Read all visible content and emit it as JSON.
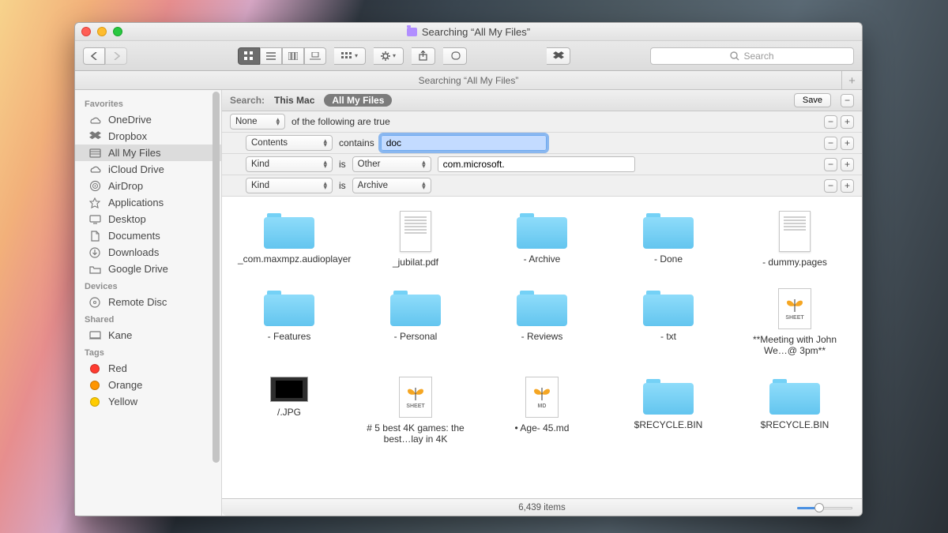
{
  "window_title": "Searching “All My Files”",
  "tab_title": "Searching “All My Files”",
  "toolbar": {
    "search_placeholder": "Search"
  },
  "sidebar": {
    "sections": [
      {
        "header": "Favorites",
        "items": [
          {
            "icon": "onedrive",
            "label": "OneDrive"
          },
          {
            "icon": "dropbox",
            "label": "Dropbox"
          },
          {
            "icon": "allmyfiles",
            "label": "All My Files",
            "selected": true
          },
          {
            "icon": "icloud",
            "label": "iCloud Drive"
          },
          {
            "icon": "airdrop",
            "label": "AirDrop"
          },
          {
            "icon": "applications",
            "label": "Applications"
          },
          {
            "icon": "desktop",
            "label": "Desktop"
          },
          {
            "icon": "documents",
            "label": "Documents"
          },
          {
            "icon": "downloads",
            "label": "Downloads"
          },
          {
            "icon": "folder",
            "label": "Google Drive"
          }
        ]
      },
      {
        "header": "Devices",
        "items": [
          {
            "icon": "disc",
            "label": "Remote Disc"
          }
        ]
      },
      {
        "header": "Shared",
        "items": [
          {
            "icon": "computer",
            "label": "Kane"
          }
        ]
      },
      {
        "header": "Tags",
        "items": [
          {
            "icon": "tag",
            "color": "#ff3b30",
            "label": "Red"
          },
          {
            "icon": "tag",
            "color": "#ff9500",
            "label": "Orange"
          },
          {
            "icon": "tag",
            "color": "#ffcc00",
            "label": "Yellow"
          }
        ]
      }
    ]
  },
  "search": {
    "label": "Search:",
    "scope_this_mac": "This Mac",
    "scope_active": "All My Files",
    "save_label": "Save"
  },
  "criteria": [
    {
      "level": 0,
      "attr": "None",
      "text": "of the following are true"
    },
    {
      "level": 1,
      "attr": "Contents",
      "op": "contains",
      "value": "doc",
      "focused": true
    },
    {
      "level": 1,
      "attr": "Kind",
      "op": "is",
      "value_select": "Other",
      "value_text": "com.microsoft."
    },
    {
      "level": 1,
      "attr": "Kind",
      "op": "is",
      "value_select": "Archive"
    }
  ],
  "files": [
    {
      "type": "folder",
      "name": "_com.maxmpz.audioplayer"
    },
    {
      "type": "pdf",
      "name": "_jubilat.pdf"
    },
    {
      "type": "folder",
      "name": "- Archive"
    },
    {
      "type": "folder",
      "name": "- Done"
    },
    {
      "type": "pages",
      "name": "- dummy.pages"
    },
    {
      "type": "folder",
      "name": "- Features"
    },
    {
      "type": "folder",
      "name": "- Personal"
    },
    {
      "type": "folder",
      "name": "- Reviews"
    },
    {
      "type": "folder",
      "name": "- txt"
    },
    {
      "type": "sheet",
      "name": "**Meeting with John We…@ 3pm**"
    },
    {
      "type": "jpg",
      "name": "/.JPG"
    },
    {
      "type": "sheet",
      "name": "# 5 best 4K games: the best…lay in 4K"
    },
    {
      "type": "md",
      "name": "• Age- 45.md"
    },
    {
      "type": "folder",
      "name": "$RECYCLE.BIN"
    },
    {
      "type": "folder",
      "name": "$RECYCLE.BIN"
    }
  ],
  "status": {
    "items": "6,439 items"
  }
}
